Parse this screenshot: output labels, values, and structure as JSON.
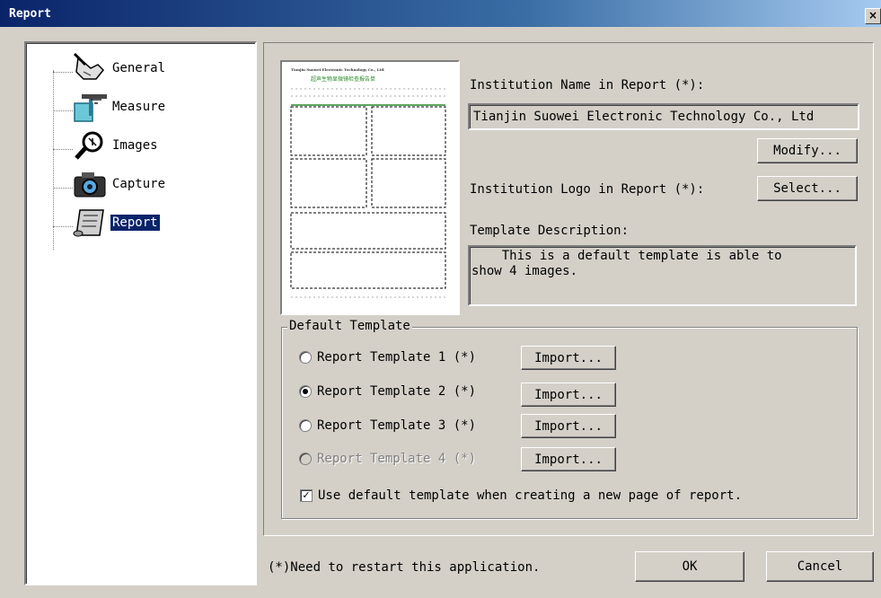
{
  "window": {
    "title": "Report",
    "close_glyph": "×"
  },
  "tree": {
    "items": [
      {
        "label": "General",
        "icon": "hand-pointer-icon"
      },
      {
        "label": "Measure",
        "icon": "ruler-square-icon"
      },
      {
        "label": "Images",
        "icon": "magnifier-icon"
      },
      {
        "label": "Capture",
        "icon": "camera-icon"
      },
      {
        "label": "Report",
        "icon": "scroll-icon",
        "selected": true
      }
    ]
  },
  "preview": {
    "company_line": "Tianjin Suowei Electronic Technology Co., Ltd.",
    "title_line": "超声生物显微镜检查报告单"
  },
  "institution": {
    "name_label": "Institution Name in Report (*):",
    "name_value": "Tianjin Suowei Electronic Technology Co., Ltd",
    "modify_label": "Modify...",
    "logo_label": "Institution Logo in Report (*):",
    "select_label": "Select..."
  },
  "template": {
    "desc_label": "Template Description:",
    "desc_value": "    This is a default template is able to\nshow 4 images."
  },
  "default_template": {
    "group_label": "Default Template",
    "options": [
      {
        "label": "Report Template 1 (*)",
        "selected": false,
        "enabled": true
      },
      {
        "label": "Report Template 2 (*)",
        "selected": true,
        "enabled": true
      },
      {
        "label": "Report Template 3 (*)",
        "selected": false,
        "enabled": true
      },
      {
        "label": "Report Template 4 (*)",
        "selected": false,
        "enabled": false
      }
    ],
    "import_label": "Import...",
    "use_default_label": "Use default template when creating a new page of report.",
    "use_default_checked": true
  },
  "footer": {
    "note": "(*)Need to restart this application.",
    "ok_label": "OK",
    "cancel_label": "Cancel"
  },
  "colors": {
    "face": "#d4d0c8",
    "title_start": "#0a246a",
    "selection": "#0a246a"
  }
}
